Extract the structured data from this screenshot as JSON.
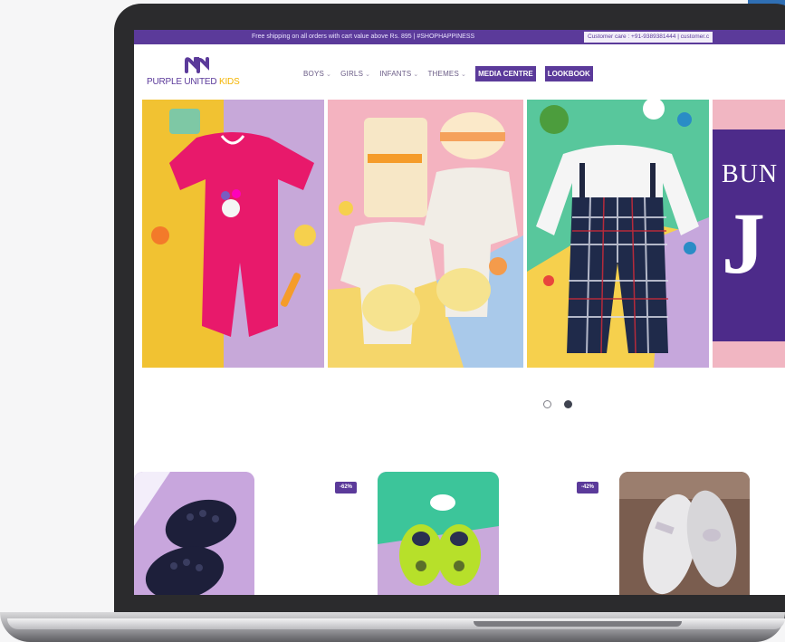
{
  "topbar": {
    "shipping_text": "Free shipping on all orders with cart value above Rs. 895 | #SHOPHAPPINESS",
    "customer_care": "Customer care : +91-9389381444  |  customer.c"
  },
  "brand": {
    "logo_text_main": "PURPLE UNITED ",
    "logo_text_accent": "KIDS"
  },
  "nav": {
    "items": [
      {
        "label": "BOYS"
      },
      {
        "label": "GIRLS"
      },
      {
        "label": "INFANTS"
      },
      {
        "label": "THEMES"
      }
    ],
    "chevron_icon": "chevron-down-icon",
    "media_centre": "MEDIA CENTRE",
    "lookbook": "LOOKBOOK"
  },
  "hero": {
    "promo_line1": "BUN",
    "promo_line2": "J",
    "slide_count": 2,
    "active_slide": 2
  },
  "products": {
    "badges": [
      "-62%",
      "-42%"
    ]
  },
  "colors": {
    "brand_purple": "#5b3a9a",
    "accent_yellow": "#f4b400",
    "laptop_frame": "#2b2b2d"
  }
}
